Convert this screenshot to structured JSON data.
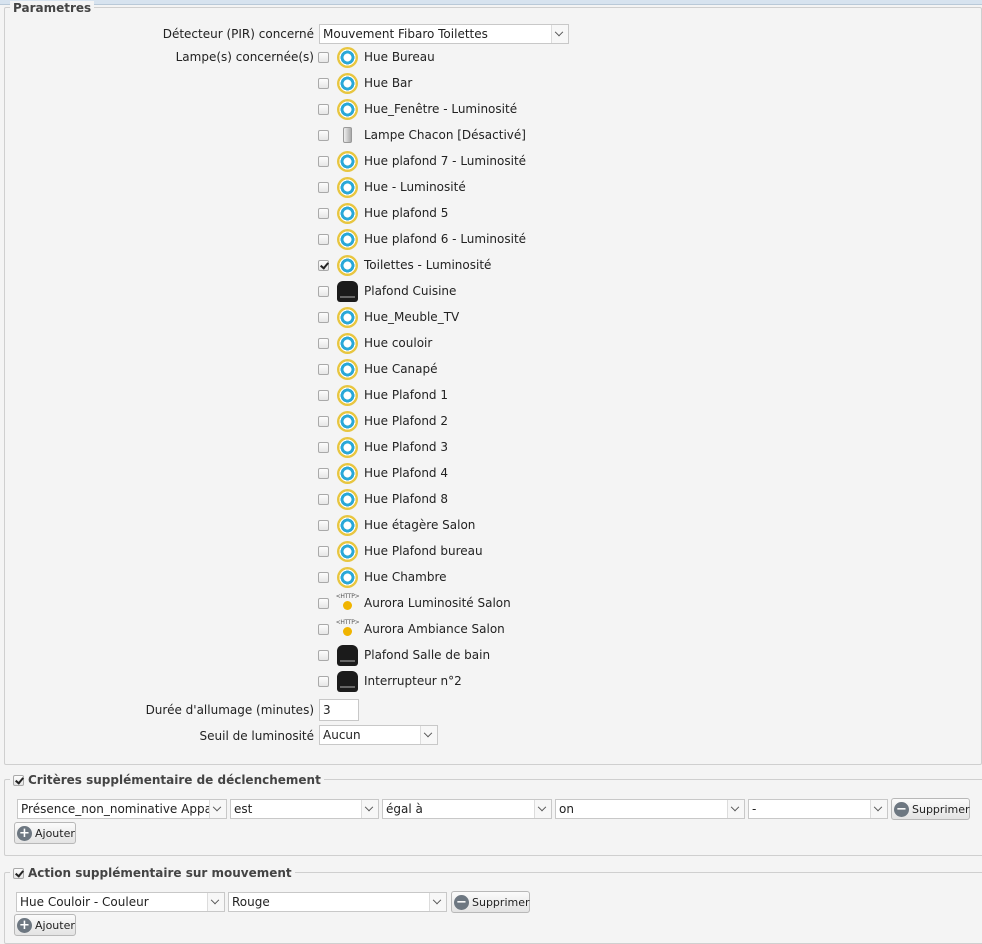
{
  "parametres": {
    "legend": "Parametres",
    "detector_label": "Détecteur (PIR) concerné",
    "detector_value": "Mouvement Fibaro Toilettes",
    "lamps_label": "Lampe(s) concernée(s)",
    "lamps": [
      {
        "label": "Hue Bureau",
        "icon": "hue-bulb-icon",
        "checked": false
      },
      {
        "label": "Hue Bar",
        "icon": "hue-bulb-icon",
        "checked": false
      },
      {
        "label": "Hue_Fenêtre - Luminosité",
        "icon": "hue-bulb-icon",
        "checked": false
      },
      {
        "label": "Lampe Chacon [Désactivé]",
        "icon": "chacon-plug-icon",
        "checked": false
      },
      {
        "label": "Hue plafond 7 - Luminosité",
        "icon": "hue-bulb-icon",
        "checked": false
      },
      {
        "label": "Hue - Luminosité",
        "icon": "hue-bulb-icon",
        "checked": false
      },
      {
        "label": "Hue plafond 5",
        "icon": "hue-bulb-icon",
        "checked": false
      },
      {
        "label": "Hue plafond 6 - Luminosité",
        "icon": "hue-bulb-icon",
        "checked": false
      },
      {
        "label": "Toilettes - Luminosité",
        "icon": "hue-bulb-icon",
        "checked": true
      },
      {
        "label": "Plafond Cuisine",
        "icon": "dimmer-module-icon",
        "checked": false
      },
      {
        "label": "Hue_Meuble_TV",
        "icon": "hue-bulb-icon",
        "checked": false
      },
      {
        "label": "Hue couloir",
        "icon": "hue-bulb-icon",
        "checked": false
      },
      {
        "label": "Hue Canapé",
        "icon": "hue-bulb-icon",
        "checked": false
      },
      {
        "label": "Hue Plafond 1",
        "icon": "hue-bulb-icon",
        "checked": false
      },
      {
        "label": "Hue Plafond 2",
        "icon": "hue-bulb-icon",
        "checked": false
      },
      {
        "label": "Hue Plafond 3",
        "icon": "hue-bulb-icon",
        "checked": false
      },
      {
        "label": "Hue Plafond 4",
        "icon": "hue-bulb-icon",
        "checked": false
      },
      {
        "label": "Hue Plafond 8",
        "icon": "hue-bulb-icon",
        "checked": false
      },
      {
        "label": "Hue étagère Salon",
        "icon": "hue-bulb-icon",
        "checked": false
      },
      {
        "label": "Hue Plafond bureau",
        "icon": "hue-bulb-icon",
        "checked": false
      },
      {
        "label": "Hue Chambre",
        "icon": "hue-bulb-icon",
        "checked": false
      },
      {
        "label": "Aurora Luminosité Salon",
        "icon": "http-device-icon",
        "checked": false
      },
      {
        "label": "Aurora Ambiance Salon",
        "icon": "http-device-icon",
        "checked": false
      },
      {
        "label": "Plafond Salle de bain",
        "icon": "dimmer-module-icon",
        "checked": false
      },
      {
        "label": "Interrupteur n°2",
        "icon": "dimmer-module-icon",
        "checked": false
      }
    ],
    "http_icon_text": "<HTTP>",
    "duration_label": "Durée d'allumage (minutes)",
    "duration_value": "3",
    "threshold_label": "Seuil de luminosité",
    "threshold_value": "Aucun"
  },
  "criteres": {
    "legend": "Critères supplémentaire de déclenchement",
    "checked": true,
    "row": {
      "variable": "Présence_non_nominative Apparte",
      "operator1": "est",
      "operator2": "égal à",
      "value": "on",
      "extra": "-"
    },
    "remove_label": "Supprimer",
    "add_label": "Ajouter"
  },
  "action": {
    "legend": "Action supplémentaire sur mouvement",
    "checked": true,
    "row": {
      "device": "Hue Couloir - Couleur",
      "value": "Rouge"
    },
    "remove_label": "Supprimer",
    "add_label": "Ajouter"
  }
}
